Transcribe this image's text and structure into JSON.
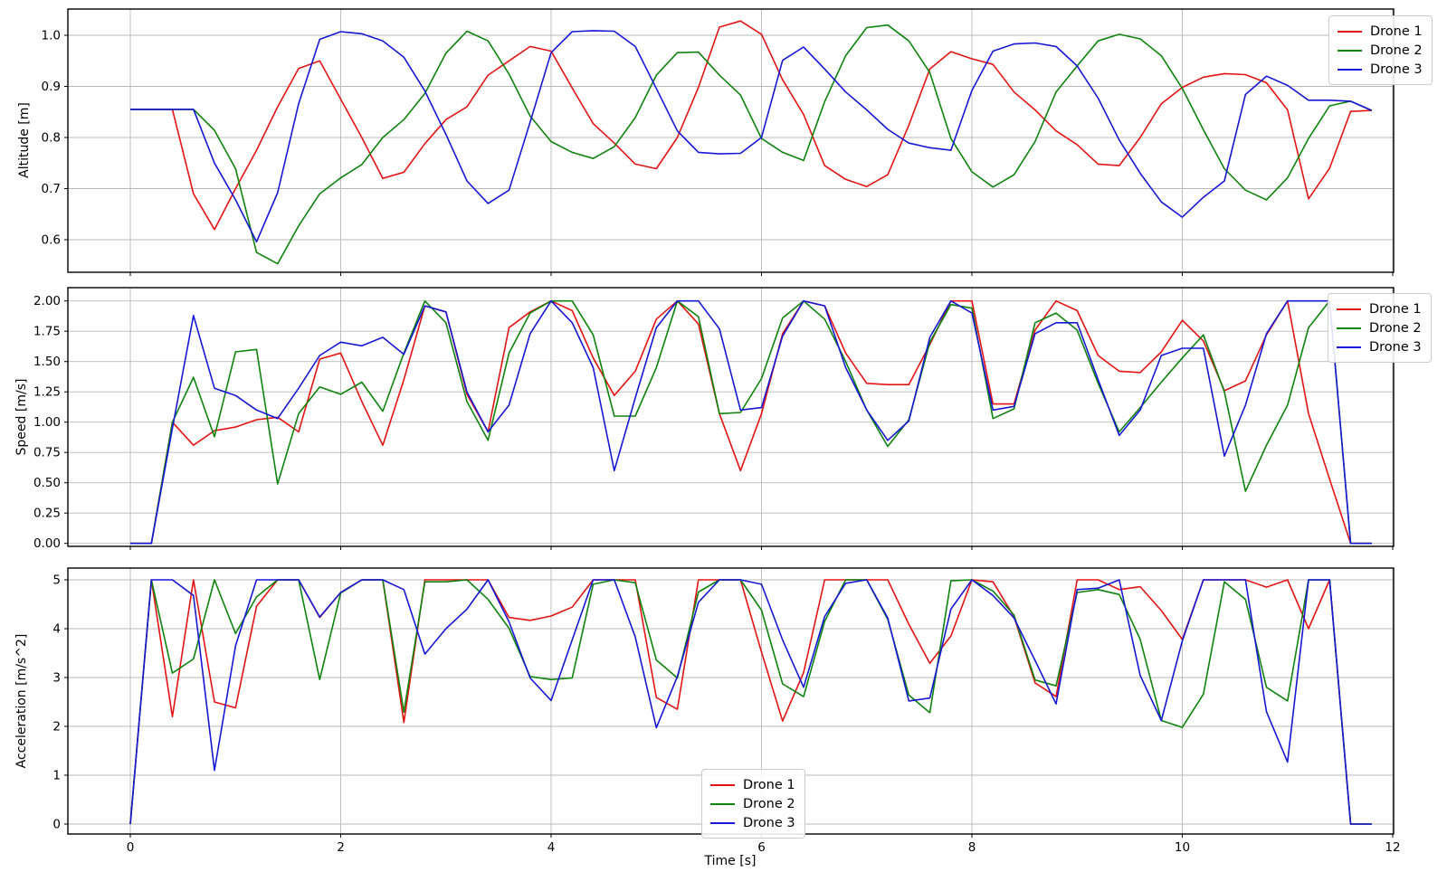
{
  "figure": {
    "background": "#ffffff"
  },
  "chart_data": [
    {
      "type": "line",
      "title": "",
      "xlabel": "Time [s]",
      "ylabel": "Altitude [m]",
      "x_start": 0,
      "x_step": 0.2,
      "xlim": [
        -0.6,
        12.03
      ],
      "ylim": [
        0.536,
        1.051
      ],
      "grid": true,
      "legend_position": "upper right",
      "xticks": [
        "0",
        "2",
        "4",
        "6",
        "8",
        "10",
        "12"
      ],
      "yticks": [
        "0.6",
        "0.7",
        "0.8",
        "0.9",
        "1.0"
      ],
      "series": [
        {
          "name": "Drone 1",
          "color": "#e41414",
          "values": [
            0.855,
            0.855,
            0.855,
            0.69,
            0.62,
            0.7,
            0.775,
            0.86,
            0.935,
            0.95,
            0.875,
            0.8,
            0.72,
            0.732,
            0.788,
            0.835,
            0.86,
            0.922,
            0.95,
            0.978,
            0.969,
            0.897,
            0.827,
            0.789,
            0.748,
            0.739,
            0.8,
            0.898,
            1.016,
            1.028,
            1.002,
            0.913,
            0.845,
            0.745,
            0.718,
            0.704,
            0.727,
            0.824,
            0.934,
            0.968,
            0.954,
            0.943,
            0.889,
            0.854,
            0.813,
            0.786,
            0.748,
            0.745,
            0.8,
            0.866,
            0.898,
            0.918,
            0.925,
            0.923,
            0.907,
            0.854,
            0.68,
            0.74,
            0.851,
            0.853
          ]
        },
        {
          "name": "Drone 2",
          "color": "#0e830e",
          "values": [
            0.855,
            0.855,
            0.855,
            0.855,
            0.814,
            0.739,
            0.575,
            0.553,
            0.627,
            0.69,
            0.721,
            0.747,
            0.8,
            0.835,
            0.886,
            0.965,
            1.008,
            0.989,
            0.924,
            0.842,
            0.792,
            0.771,
            0.759,
            0.782,
            0.839,
            0.922,
            0.966,
            0.967,
            0.922,
            0.883,
            0.798,
            0.771,
            0.755,
            0.87,
            0.96,
            1.015,
            1.02,
            0.989,
            0.927,
            0.798,
            0.733,
            0.703,
            0.727,
            0.792,
            0.889,
            0.94,
            0.989,
            1.002,
            0.993,
            0.96,
            0.896,
            0.815,
            0.739,
            0.697,
            0.678,
            0.721,
            0.798,
            0.862,
            0.871,
            0.853
          ]
        },
        {
          "name": "Drone 3",
          "color": "#1717d6",
          "values": [
            0.855,
            0.855,
            0.855,
            0.855,
            0.75,
            0.678,
            0.596,
            0.692,
            0.866,
            0.992,
            1.007,
            1.003,
            0.989,
            0.957,
            0.891,
            0.806,
            0.715,
            0.671,
            0.697,
            0.83,
            0.966,
            1.007,
            1.009,
            1.008,
            0.978,
            0.896,
            0.813,
            0.771,
            0.768,
            0.769,
            0.8,
            0.951,
            0.977,
            0.934,
            0.889,
            0.854,
            0.816,
            0.789,
            0.78,
            0.775,
            0.892,
            0.969,
            0.983,
            0.985,
            0.978,
            0.94,
            0.877,
            0.795,
            0.73,
            0.674,
            0.644,
            0.683,
            0.715,
            0.884,
            0.92,
            0.902,
            0.873,
            0.873,
            0.871,
            0.853
          ]
        }
      ]
    },
    {
      "type": "line",
      "title": "",
      "xlabel": "Time [s]",
      "ylabel": "Speed [m/s]",
      "x_start": 0,
      "x_step": 0.2,
      "xlim": [
        -0.6,
        12.03
      ],
      "ylim": [
        -0.03,
        2.11
      ],
      "grid": true,
      "legend_position": "upper right",
      "xticks": [
        "0",
        "2",
        "4",
        "6",
        "8",
        "10",
        "12"
      ],
      "yticks": [
        "0.00",
        "0.25",
        "0.50",
        "0.75",
        "1.00",
        "1.25",
        "1.50",
        "1.75",
        "2.00"
      ],
      "series": [
        {
          "name": "Drone 1",
          "color": "#e41414",
          "values": [
            0,
            0,
            1.0,
            0.81,
            0.93,
            0.96,
            1.02,
            1.04,
            0.92,
            1.52,
            1.57,
            1.17,
            0.81,
            1.35,
            1.96,
            1.91,
            1.23,
            0.92,
            1.78,
            1.91,
            2.0,
            1.92,
            1.53,
            1.22,
            1.42,
            1.85,
            2.0,
            1.81,
            1.07,
            0.6,
            1.07,
            1.73,
            2.0,
            1.96,
            1.57,
            1.32,
            1.31,
            1.31,
            1.64,
            2.0,
            2.0,
            1.15,
            1.15,
            1.76,
            2.0,
            1.92,
            1.55,
            1.42,
            1.41,
            1.58,
            1.84,
            1.67,
            1.26,
            1.34,
            1.72,
            2.0,
            1.07,
            0.53,
            0,
            0
          ]
        },
        {
          "name": "Drone 2",
          "color": "#0e830e",
          "values": [
            0,
            0,
            1.0,
            1.37,
            0.88,
            1.58,
            1.6,
            0.49,
            1.07,
            1.29,
            1.23,
            1.33,
            1.09,
            1.57,
            2.0,
            1.82,
            1.17,
            0.85,
            1.57,
            1.9,
            2.0,
            2.0,
            1.72,
            1.05,
            1.05,
            1.45,
            2.0,
            1.87,
            1.07,
            1.08,
            1.36,
            1.86,
            2.0,
            1.85,
            1.5,
            1.1,
            0.8,
            1.02,
            1.66,
            1.97,
            1.94,
            1.03,
            1.11,
            1.82,
            1.9,
            1.76,
            1.32,
            0.92,
            1.12,
            1.33,
            1.53,
            1.72,
            1.25,
            0.43,
            0.81,
            1.14,
            1.78,
            2.0,
            0,
            0
          ]
        },
        {
          "name": "Drone 3",
          "color": "#1717d6",
          "values": [
            0,
            0,
            0.95,
            1.88,
            1.28,
            1.22,
            1.1,
            1.03,
            1.28,
            1.55,
            1.66,
            1.63,
            1.7,
            1.56,
            1.96,
            1.91,
            1.25,
            0.92,
            1.14,
            1.73,
            2.0,
            1.82,
            1.45,
            0.6,
            1.2,
            1.78,
            2.0,
            2.0,
            1.77,
            1.1,
            1.12,
            1.71,
            2.0,
            1.96,
            1.45,
            1.1,
            0.85,
            1.01,
            1.7,
            2.0,
            1.9,
            1.1,
            1.13,
            1.73,
            1.82,
            1.82,
            1.35,
            0.89,
            1.1,
            1.55,
            1.61,
            1.61,
            0.72,
            1.14,
            1.73,
            2.0,
            2.0,
            2.0,
            0,
            0
          ]
        }
      ]
    },
    {
      "type": "line",
      "title": "",
      "xlabel": "Time [s]",
      "ylabel": "Acceleration [m/s^2]",
      "x_start": 0,
      "x_step": 0.2,
      "xlim": [
        -0.6,
        12.03
      ],
      "ylim": [
        -0.2,
        5.24
      ],
      "grid": true,
      "legend_position": "lower center",
      "xticks": [
        "0",
        "2",
        "4",
        "6",
        "8",
        "10",
        "12"
      ],
      "yticks": [
        "0",
        "1",
        "2",
        "3",
        "4",
        "5"
      ],
      "series": [
        {
          "name": "Drone 1",
          "color": "#e41414",
          "values": [
            0,
            5,
            2.2,
            5,
            2.5,
            2.38,
            4.46,
            5,
            5,
            4.23,
            4.74,
            5,
            5,
            2.08,
            5,
            5,
            5,
            5,
            4.23,
            4.17,
            4.26,
            4.44,
            5,
            5,
            5,
            2.59,
            2.35,
            5,
            5,
            5,
            3.52,
            2.11,
            3.1,
            5,
            5,
            5,
            5,
            4.09,
            3.29,
            3.85,
            5,
            4.96,
            4.25,
            2.89,
            2.61,
            5,
            5,
            4.8,
            4.86,
            4.37,
            3.78,
            5,
            5,
            5,
            4.85,
            5,
            4.0,
            5,
            0,
            0
          ]
        },
        {
          "name": "Drone 2",
          "color": "#0e830e",
          "values": [
            0,
            5,
            3.09,
            3.38,
            5,
            3.9,
            4.65,
            5,
            5,
            2.96,
            4.73,
            5,
            5,
            2.29,
            4.96,
            4.96,
            5,
            4.6,
            4.01,
            3.02,
            2.96,
            2.99,
            4.91,
            5,
            4.94,
            3.36,
            2.99,
            4.75,
            5,
            5,
            4.38,
            2.87,
            2.61,
            4.15,
            5,
            5,
            4.19,
            2.64,
            2.28,
            4.98,
            5,
            4.77,
            4.28,
            2.95,
            2.83,
            4.74,
            4.8,
            4.7,
            3.78,
            2.12,
            1.98,
            2.66,
            4.96,
            4.6,
            2.8,
            2.52,
            5,
            5,
            0,
            0
          ]
        },
        {
          "name": "Drone 3",
          "color": "#1717d6",
          "values": [
            0,
            5,
            5,
            4.68,
            1.1,
            3.65,
            5,
            5,
            5,
            4.24,
            4.74,
            5,
            5,
            4.8,
            3.48,
            4.0,
            4.4,
            5,
            4.14,
            2.99,
            2.53,
            3.77,
            5,
            5,
            3.83,
            1.97,
            3.02,
            4.54,
            5,
            5,
            4.91,
            3.77,
            2.8,
            4.25,
            4.93,
            5,
            4.22,
            2.52,
            2.58,
            4.4,
            5,
            4.68,
            4.22,
            3.35,
            2.46,
            4.8,
            4.83,
            5,
            3.04,
            2.12,
            3.75,
            5,
            5,
            5,
            2.3,
            1.27,
            5,
            5,
            0,
            0
          ]
        }
      ]
    }
  ]
}
